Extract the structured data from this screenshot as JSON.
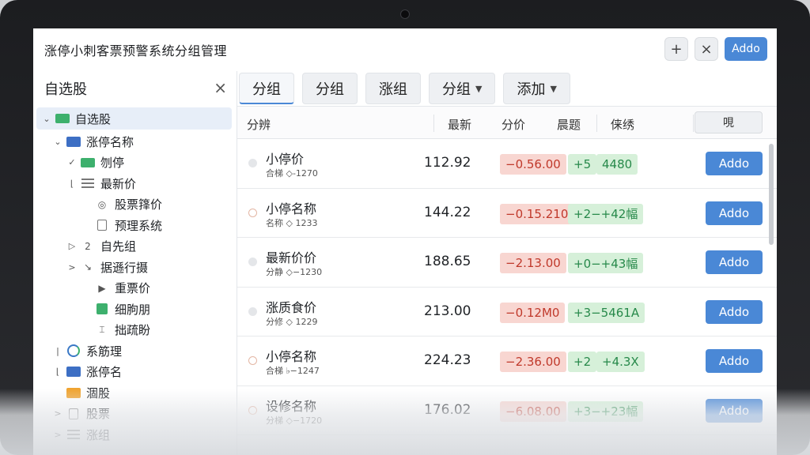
{
  "app": {
    "title": "涨停小刺客票预警系统分组管理"
  },
  "window_buttons": {
    "plus_label": "+",
    "close_label": "×",
    "add_label": "Addo"
  },
  "sidebar": {
    "title": "自选股",
    "close_label": "×",
    "items": [
      {
        "label": "自选股",
        "arrow": "⌄",
        "icon": "folder-green",
        "level": 0,
        "selected": true
      },
      {
        "label": "涨停名称",
        "arrow": "⌄",
        "icon": "folder-blue",
        "level": 1
      },
      {
        "label": "刎停",
        "arrow": "✓",
        "icon": "folder-green",
        "level": 2
      },
      {
        "label": "最新价",
        "arrow": "⌊",
        "icon": "lines",
        "level": 2
      },
      {
        "label": "股票箨价",
        "arrow": "",
        "icon": "radio",
        "level": 3
      },
      {
        "label": "预理系统",
        "arrow": "",
        "icon": "doc",
        "level": 3
      },
      {
        "label": "自先组",
        "arrow": "▷",
        "icon": "two",
        "level": 2
      },
      {
        "label": "据遜行摄",
        "arrow": ">",
        "icon": "arrow",
        "level": 2
      },
      {
        "label": "重票价",
        "arrow": "",
        "icon": "play",
        "level": 3
      },
      {
        "label": "细朐朋",
        "arrow": "",
        "icon": "green-box",
        "level": 3
      },
      {
        "label": "拙疏盼",
        "arrow": "",
        "icon": "bracket",
        "level": 3
      },
      {
        "label": "系筋理",
        "arrow": "|",
        "icon": "circle-g",
        "level": 1
      },
      {
        "label": "涨停名",
        "arrow": "⌊",
        "icon": "folder-blue",
        "level": 1
      },
      {
        "label": "涸股",
        "arrow": "",
        "icon": "folder-orange",
        "level": 1
      },
      {
        "label": "股票",
        "arrow": ">",
        "icon": "doc",
        "level": 1
      },
      {
        "label": "涨组",
        "arrow": ">",
        "icon": "lines",
        "level": 1
      }
    ]
  },
  "tabs": [
    {
      "label": "分组",
      "active": true,
      "dropdown": false
    },
    {
      "label": "分组",
      "active": false,
      "dropdown": false
    },
    {
      "label": "涨组",
      "active": false,
      "dropdown": false
    },
    {
      "label": "分组",
      "active": false,
      "dropdown": true
    },
    {
      "label": "添加",
      "active": false,
      "dropdown": true
    }
  ],
  "table": {
    "headers": {
      "name": "分辨",
      "latest": "最新",
      "change": "分价",
      "volume": "晨题",
      "misc": "俫绣",
      "action": "哯"
    },
    "rows": [
      {
        "name": "小停价",
        "sub": "合梯 ◇-1270",
        "price": "112.92",
        "chg": "−0.56.00",
        "pill2": "+5",
        "pill3": "4480",
        "add": "Addo",
        "dot": "grey"
      },
      {
        "name": "小停名称",
        "sub": "名称 ◇ 1233",
        "price": "144.22",
        "chg": "−0.15.210",
        "pill2": "+2−+42幅",
        "pill3": "",
        "add": "Addo",
        "dot": "open"
      },
      {
        "name": "最新价价",
        "sub": "分静 ◇−1230",
        "price": "188.65",
        "chg": "−2.13.00",
        "pill2": "+0−+43幅",
        "pill3": "",
        "add": "Addo",
        "dot": "grey"
      },
      {
        "name": "涨质食价",
        "sub": "分修 ◇ 1229",
        "price": "213.00",
        "chg": "−0.12M0",
        "pill2": "+3−5461A",
        "pill3": "",
        "add": "Addo",
        "dot": "grey"
      },
      {
        "name": "小停名称",
        "sub": "合梯 ♭−1247",
        "price": "224.23",
        "chg": "−2.36.00",
        "pill2": "+2",
        "pill3": "+4.3X",
        "add": "Addo",
        "dot": "open"
      },
      {
        "name": "设修名称",
        "sub": "分梯 ◇−1720",
        "price": "176.02",
        "chg": "−6.08.00",
        "pill2": "+3−+23幅",
        "pill3": "",
        "add": "Addo",
        "dot": "open"
      }
    ]
  },
  "colors": {
    "accent": "#4a88d6",
    "up": "#27894a",
    "down": "#c0392b"
  }
}
